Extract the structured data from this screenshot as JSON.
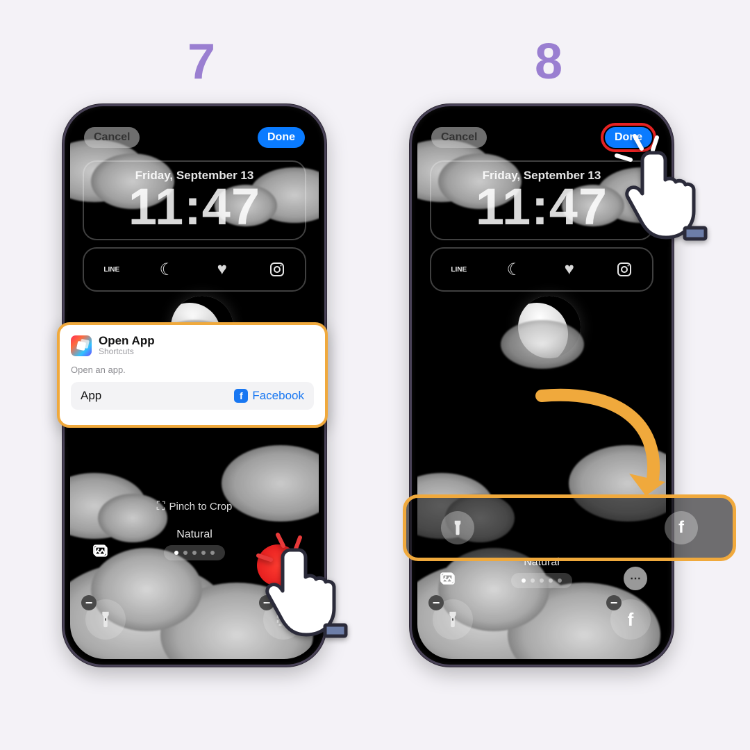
{
  "steps": {
    "s7": "7",
    "s8": "8"
  },
  "nav": {
    "cancel": "Cancel",
    "done": "Done"
  },
  "lock": {
    "date": "Friday, September 13",
    "time": "11:47"
  },
  "widgets": {
    "line_label": "LINE"
  },
  "pinch": "Pinch to Crop",
  "style": {
    "label": "Natural"
  },
  "popup": {
    "title": "Open App",
    "subtitle": "Shortcuts",
    "desc": "Open an app.",
    "row_label": "App",
    "row_value": "Facebook"
  }
}
